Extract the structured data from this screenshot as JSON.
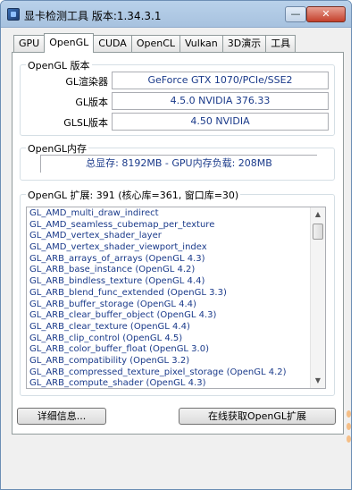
{
  "window": {
    "title": "显卡检测工具 版本:1.34.3.1",
    "minimize_label": "—",
    "close_label": "✕"
  },
  "tabs": [
    {
      "label": "GPU"
    },
    {
      "label": "OpenGL"
    },
    {
      "label": "CUDA"
    },
    {
      "label": "OpenCL"
    },
    {
      "label": "Vulkan"
    },
    {
      "label": "3D演示"
    },
    {
      "label": "工具"
    }
  ],
  "opengl_version": {
    "group_title": "OpenGL 版本",
    "renderer_label": "GL渲染器",
    "renderer_value": "GeForce GTX 1070/PCIe/SSE2",
    "gl_version_label": "GL版本",
    "gl_version_value": "4.5.0 NVIDIA 376.33",
    "glsl_version_label": "GLSL版本",
    "glsl_version_value": "4.50 NVIDIA"
  },
  "opengl_memory": {
    "group_title": "OpenGL内存",
    "summary": "总显存: 8192MB - GPU内存负载: 208MB"
  },
  "extensions": {
    "group_title": "OpenGL 扩展: 391 (核心库=361, 窗口库=30)",
    "items": [
      "GL_AMD_multi_draw_indirect",
      "GL_AMD_seamless_cubemap_per_texture",
      "GL_AMD_vertex_shader_layer",
      "GL_AMD_vertex_shader_viewport_index",
      "GL_ARB_arrays_of_arrays (OpenGL 4.3)",
      "GL_ARB_base_instance (OpenGL 4.2)",
      "GL_ARB_bindless_texture (OpenGL 4.4)",
      "GL_ARB_blend_func_extended (OpenGL 3.3)",
      "GL_ARB_buffer_storage (OpenGL 4.4)",
      "GL_ARB_clear_buffer_object (OpenGL 4.3)",
      "GL_ARB_clear_texture (OpenGL 4.4)",
      "GL_ARB_clip_control (OpenGL 4.5)",
      "GL_ARB_color_buffer_float (OpenGL 3.0)",
      "GL_ARB_compatibility (OpenGL 3.2)",
      "GL_ARB_compressed_texture_pixel_storage (OpenGL 4.2)",
      "GL_ARB_compute_shader (OpenGL 4.3)"
    ]
  },
  "buttons": {
    "details": "详细信息...",
    "online_extensions": "在线获取OpenGL扩展"
  }
}
